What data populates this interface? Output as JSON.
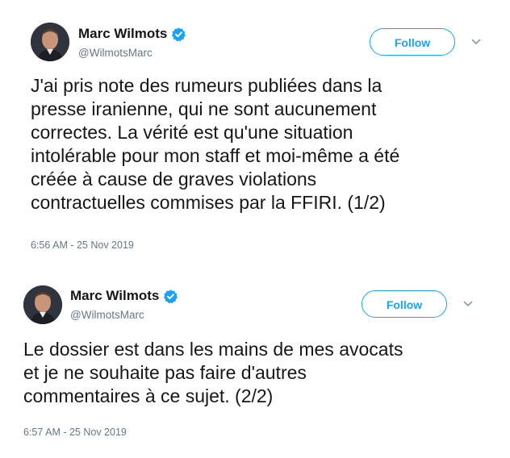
{
  "colors": {
    "accent": "#1da1f2",
    "text": "#14171a",
    "secondary_text": "#657786",
    "background": "#ffffff"
  },
  "icons": {
    "verified": "verified-badge-icon",
    "menu": "chevron-down-icon"
  },
  "tweets": [
    {
      "author": {
        "name": "Marc Wilmots",
        "handle": "@WilmotsMarc",
        "verified": true
      },
      "follow_label": "Follow",
      "text_lines": [
        "J'ai pris note des rumeurs publiées dans la",
        "presse iranienne, qui ne sont aucunement",
        "correctes. La vérité est qu'une situation",
        "intolérable pour mon staff et moi-même a été",
        "créée à cause de graves violations",
        "contractuelles commises par la FFIRI. (1/2)"
      ],
      "timestamp": "6:56 AM - 25 Nov 2019"
    },
    {
      "author": {
        "name": "Marc Wilmots",
        "handle": "@WilmotsMarc",
        "verified": true
      },
      "follow_label": "Follow",
      "text_lines": [
        "Le dossier est dans les mains de mes avocats",
        "et je ne souhaite pas faire d'autres",
        "commentaires à ce sujet. (2/2)"
      ],
      "timestamp": "6:57 AM - 25 Nov 2019"
    }
  ]
}
